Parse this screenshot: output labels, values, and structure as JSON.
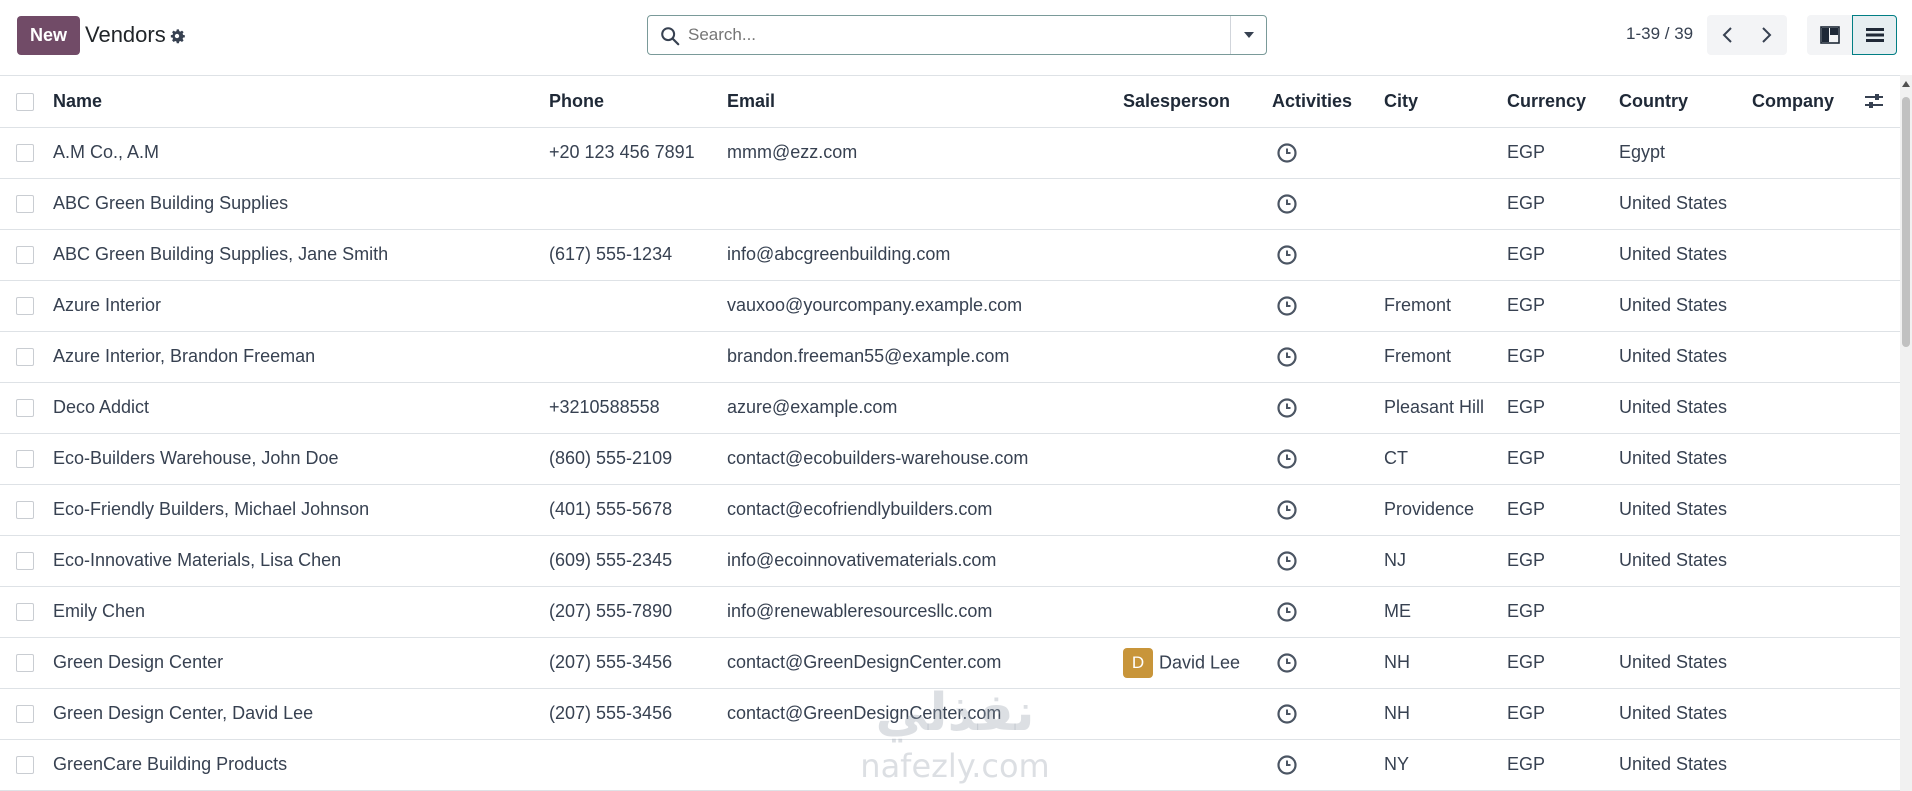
{
  "header": {
    "new_label": "New",
    "title": "Vendors",
    "search_placeholder": "Search...",
    "pager": "1-39 / 39"
  },
  "columns": {
    "name": "Name",
    "phone": "Phone",
    "email": "Email",
    "salesperson": "Salesperson",
    "activities": "Activities",
    "city": "City",
    "currency": "Currency",
    "country": "Country",
    "company": "Company"
  },
  "rows": [
    {
      "name": "A.M Co., A.M",
      "phone": "+20 123 456 7891",
      "email": "mmm@ezz.com",
      "salesperson": "",
      "city": "",
      "currency": "EGP",
      "country": "Egypt",
      "company": ""
    },
    {
      "name": "ABC Green Building Supplies",
      "phone": "",
      "email": "",
      "salesperson": "",
      "city": "",
      "currency": "EGP",
      "country": "United States",
      "company": ""
    },
    {
      "name": "ABC Green Building Supplies, Jane Smith",
      "phone": "(617) 555-1234",
      "email": "info@abcgreenbuilding.com",
      "salesperson": "",
      "city": "",
      "currency": "EGP",
      "country": "United States",
      "company": ""
    },
    {
      "name": "Azure Interior",
      "phone": "",
      "email": "vauxoo@yourcompany.example.com",
      "salesperson": "",
      "city": "Fremont",
      "currency": "EGP",
      "country": "United States",
      "company": ""
    },
    {
      "name": "Azure Interior, Brandon Freeman",
      "phone": "",
      "email": "brandon.freeman55@example.com",
      "salesperson": "",
      "city": "Fremont",
      "currency": "EGP",
      "country": "United States",
      "company": ""
    },
    {
      "name": "Deco Addict",
      "phone": "+3210588558",
      "email": "azure@example.com",
      "salesperson": "",
      "city": "Pleasant Hill",
      "currency": "EGP",
      "country": "United States",
      "company": ""
    },
    {
      "name": "Eco-Builders Warehouse, John Doe",
      "phone": "(860) 555-2109",
      "email": "contact@ecobuilders-warehouse.com",
      "salesperson": "",
      "city": "CT",
      "currency": "EGP",
      "country": "United States",
      "company": ""
    },
    {
      "name": "Eco-Friendly Builders, Michael Johnson",
      "phone": "(401) 555-5678",
      "email": "contact@ecofriendlybuilders.com",
      "salesperson": "",
      "city": "Providence",
      "currency": "EGP",
      "country": "United States",
      "company": ""
    },
    {
      "name": "Eco-Innovative Materials, Lisa Chen",
      "phone": "(609) 555-2345",
      "email": "info@ecoinnovativematerials.com",
      "salesperson": "",
      "city": "NJ",
      "currency": "EGP",
      "country": "United States",
      "company": ""
    },
    {
      "name": "Emily Chen",
      "phone": "(207) 555-7890",
      "email": "info@renewableresourcesllc.com",
      "salesperson": "",
      "city": "ME",
      "currency": "EGP",
      "country": "",
      "company": ""
    },
    {
      "name": "Green Design Center",
      "phone": "(207) 555-3456",
      "email": "contact@GreenDesignCenter.com",
      "salesperson": "David Lee",
      "salesperson_initial": "D",
      "city": "NH",
      "currency": "EGP",
      "country": "United States",
      "company": ""
    },
    {
      "name": "Green Design Center, David Lee",
      "phone": "(207) 555-3456",
      "email": "contact@GreenDesignCenter.com",
      "salesperson": "",
      "city": "NH",
      "currency": "EGP",
      "country": "United States",
      "company": ""
    },
    {
      "name": "GreenCare Building Products",
      "phone": "",
      "email": "",
      "salesperson": "",
      "city": "NY",
      "currency": "EGP",
      "country": "United States",
      "company": ""
    }
  ],
  "watermark": {
    "arabic": "نفذلي",
    "latin": "nafezly.com"
  },
  "colors": {
    "brand": "#714B67",
    "avatar": "#c8953a",
    "accent": "#017e84"
  }
}
